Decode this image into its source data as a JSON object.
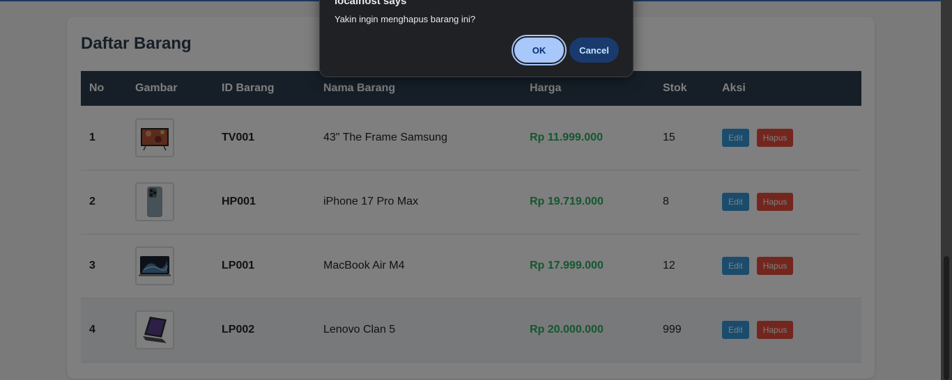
{
  "page": {
    "title": "Daftar Barang"
  },
  "table": {
    "headers": [
      "No",
      "Gambar",
      "ID Barang",
      "Nama Barang",
      "Harga",
      "Stok",
      "Aksi"
    ],
    "rows": [
      {
        "no": "1",
        "image": "tv-frame-image",
        "id": "TV001",
        "name": "43\" The Frame Samsung",
        "price": "Rp 11.999.000",
        "stock": "15"
      },
      {
        "no": "2",
        "image": "iphone-image",
        "id": "HP001",
        "name": "iPhone 17 Pro Max",
        "price": "Rp 19.719.000",
        "stock": "8"
      },
      {
        "no": "3",
        "image": "macbook-image",
        "id": "LP001",
        "name": "MacBook Air M4",
        "price": "Rp 17.999.000",
        "stock": "12"
      },
      {
        "no": "4",
        "image": "laptop-image",
        "id": "LP002",
        "name": "Lenovo Clan 5",
        "price": "Rp 20.000.000",
        "stock": "999"
      }
    ],
    "actions": {
      "edit_label": "Edit",
      "delete_label": "Hapus"
    }
  },
  "dialog": {
    "title": "localhost says",
    "message": "Yakin ingin menghapus barang ini?",
    "ok_label": "OK",
    "cancel_label": "Cancel"
  },
  "colors": {
    "header_bg": "#2c3e50",
    "price": "#27ae60",
    "edit_button": "#3498db",
    "delete_button": "#e74c3c",
    "dialog_ok": "#a8c7fa"
  }
}
